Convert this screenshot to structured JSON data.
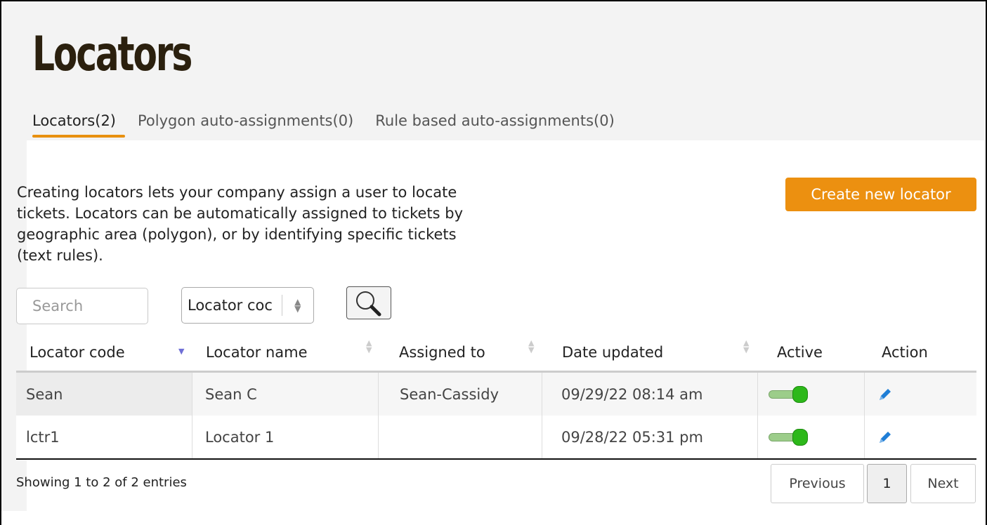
{
  "page": {
    "title": "Locators",
    "tabs": [
      {
        "label": "Locators(2)",
        "active": true
      },
      {
        "label": "Polygon auto-assignments(0)",
        "active": false
      },
      {
        "label": "Rule based auto-assignments(0)",
        "active": false
      }
    ],
    "description": "Creating locators lets your company assign a user to locate tickets. Locators can be automatically assigned to tickets by geographic area (polygon), or by identifying specific tickets (text rules).",
    "create_button": "Create new locator"
  },
  "filters": {
    "search_placeholder": "Search",
    "search_value": "",
    "field_select": "Locator coc"
  },
  "table": {
    "columns": [
      "Locator code",
      "Locator name",
      "Assigned to",
      "Date updated",
      "Active",
      "Action"
    ],
    "sorted_column": "Locator code",
    "sort_direction": "descending",
    "rows": [
      {
        "code": "Sean",
        "name": "Sean C",
        "assigned": "Sean-Cassidy",
        "updated": "09/29/22 08:14 am",
        "active": true
      },
      {
        "code": "lctr1",
        "name": "Locator 1",
        "assigned": "",
        "updated": "09/28/22 05:31 pm",
        "active": true
      }
    ]
  },
  "pagination": {
    "info": "Showing 1 to 2 of 2 entries",
    "previous": "Previous",
    "current": "1",
    "next": "Next"
  },
  "colors": {
    "accent": "#ec9010",
    "toggle_on": "#2db81a",
    "edit_icon": "#1f7ed6",
    "sort_active": "#6f6fd6"
  },
  "icons": {
    "search": "magnifier-icon",
    "sort": "sort-arrows-icon",
    "edit": "pencil-icon",
    "toggle": "toggle-switch-on"
  }
}
